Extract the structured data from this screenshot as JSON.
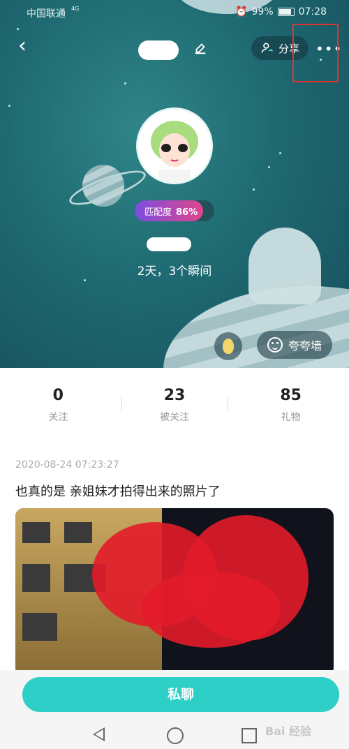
{
  "status_bar": {
    "carrier": "中国联通",
    "network": "4G",
    "battery": "99%",
    "time": "07:28"
  },
  "header": {
    "share_label": "分享",
    "more_icon": "more-dots-icon",
    "back_icon": "back-arrow-icon",
    "edit_icon": "edit-icon"
  },
  "profile": {
    "match_label": "匹配度",
    "match_value": "86%",
    "match_fraction": 0.86,
    "moments_text": "2天，3个瞬间",
    "praise_wall_label": "夸夸墙"
  },
  "stats": [
    {
      "value": "0",
      "label": "关注"
    },
    {
      "value": "23",
      "label": "被关注"
    },
    {
      "value": "85",
      "label": "礼物"
    }
  ],
  "post": {
    "timestamp": "2020-08-24 07:23:27",
    "text": "也真的是 亲姐妹才拍得出来的照片了"
  },
  "actions": {
    "private_chat": "私聊"
  },
  "watermark": "Bai 经验",
  "colors": {
    "accent": "#2ecfc6",
    "hero": "#1f6a72",
    "match_gradient_start": "#7b4de0",
    "match_gradient_end": "#e0468c"
  }
}
